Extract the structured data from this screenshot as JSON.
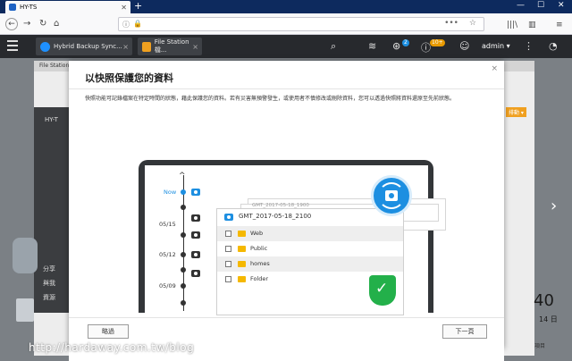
{
  "browser": {
    "tab_title": "HY-TS",
    "new_tab": "+",
    "win_min": "—",
    "win_max": "☐",
    "win_close": "✕",
    "url_info": "ⓘ",
    "url_insecure": "🔒",
    "url_more": "•••",
    "url_star": "☆",
    "back": "←",
    "forward": "→",
    "reload": "↻",
    "home": "⌂",
    "library": "|||\\",
    "sidebar": "▥",
    "menu": "≡"
  },
  "qts": {
    "tabs": [
      {
        "label": "Hybrid Backup Sync..."
      },
      {
        "label": "File Station 檔..."
      }
    ],
    "notif_count": "2",
    "event_count": "10+",
    "user": "admin ▾",
    "search_icon": "⌕",
    "more_icon": "⋮"
  },
  "background": {
    "window_title": "File Station",
    "clock": "40",
    "date": "14 日",
    "side_label_1": "HY-T",
    "side_label_2": "分享",
    "side_label_3": "與我",
    "side_label_4": "資源",
    "right_button": "排動 ▾",
    "bottom_right": "項目"
  },
  "dialog": {
    "title": "以快照保護您的資料",
    "close": "×",
    "description": "快照功能可記錄檔案在特定時間的狀態，藉此保護您的資料。若有災害無預警發生，或使用者不慎修改或刪除資料，您可以透過快照將資料還原至先前狀態。",
    "timeline": {
      "now": "Now",
      "labels": [
        "05/15",
        "05/12",
        "05/09"
      ]
    },
    "snapshot_back_title": "GMT_2017-05-18_1900",
    "snapshot_title": "GMT_2017-05-18_2100",
    "folders": [
      "Web",
      "Public",
      "homes",
      "Folder"
    ],
    "skip_label": "略過",
    "next_label": "下一頁"
  },
  "watermark": "http://hardaway.com.tw/blog"
}
